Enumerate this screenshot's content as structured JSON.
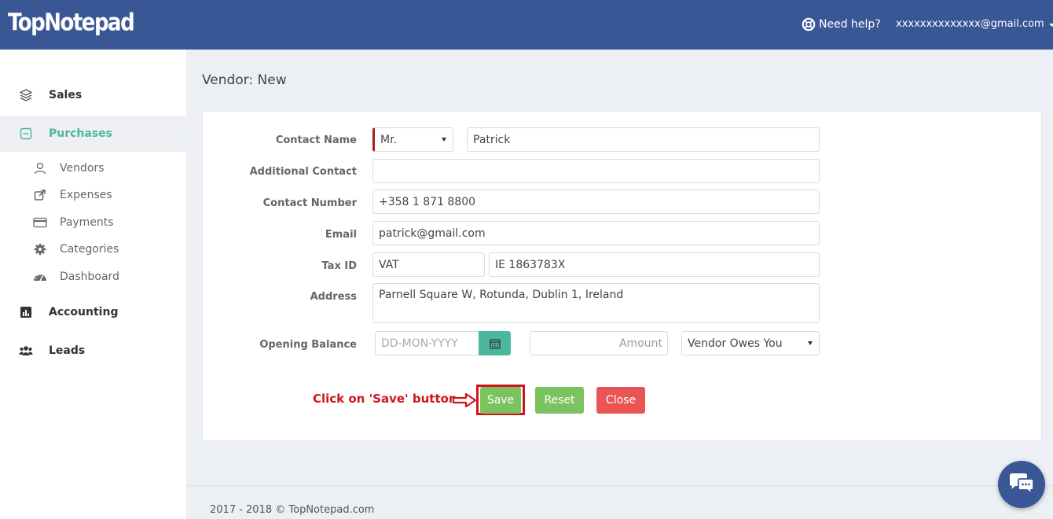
{
  "header": {
    "logo": "TopNotepad",
    "help_label": "Need help?",
    "user_email": "xxxxxxxxxxxxxx@gmail.com"
  },
  "sidebar": {
    "sections": [
      {
        "label": "Sales",
        "icon": "layers-icon"
      },
      {
        "label": "Purchases",
        "icon": "minus-square-icon",
        "active": true
      },
      {
        "label": "Accounting",
        "icon": "bar-chart-icon"
      },
      {
        "label": "Leads",
        "icon": "users-icon"
      }
    ],
    "purchases_items": [
      {
        "label": "Vendors",
        "icon": "user-icon"
      },
      {
        "label": "Expenses",
        "icon": "share-icon"
      },
      {
        "label": "Payments",
        "icon": "credit-card-icon"
      },
      {
        "label": "Categories",
        "icon": "gear-icon"
      },
      {
        "label": "Dashboard",
        "icon": "dashboard-icon"
      }
    ]
  },
  "page": {
    "title": "Vendor: New"
  },
  "form": {
    "contact_name_label": "Contact Name",
    "salutation": "Mr.",
    "contact_name": "Patrick",
    "additional_contact_label": "Additional Contact",
    "additional_contact": "",
    "contact_number_label": "Contact Number",
    "contact_number": "+358 1 871 8800",
    "email_label": "Email",
    "email": "patrick@gmail.com",
    "tax_id_label": "Tax ID",
    "tax_type": "VAT",
    "tax_id": "IE 1863783X",
    "address_label": "Address",
    "address": "Parnell Square W, Rotunda, Dublin 1, Ireland",
    "opening_balance_label": "Opening Balance",
    "date_placeholder": "DD-MON-YYYY",
    "amount_placeholder": "Amount",
    "balance_type": "Vendor Owes You"
  },
  "actions": {
    "annotation": "Click on 'Save' button",
    "save_label": "Save",
    "reset_label": "Reset",
    "close_label": "Close"
  },
  "footer": {
    "text": "2017 - 2018 © TopNotepad.com"
  },
  "colors": {
    "header": "#3a5795",
    "accent": "#4bb79c",
    "save": "#7ac35e",
    "close": "#ea5455",
    "annotation": "#d0161d"
  }
}
